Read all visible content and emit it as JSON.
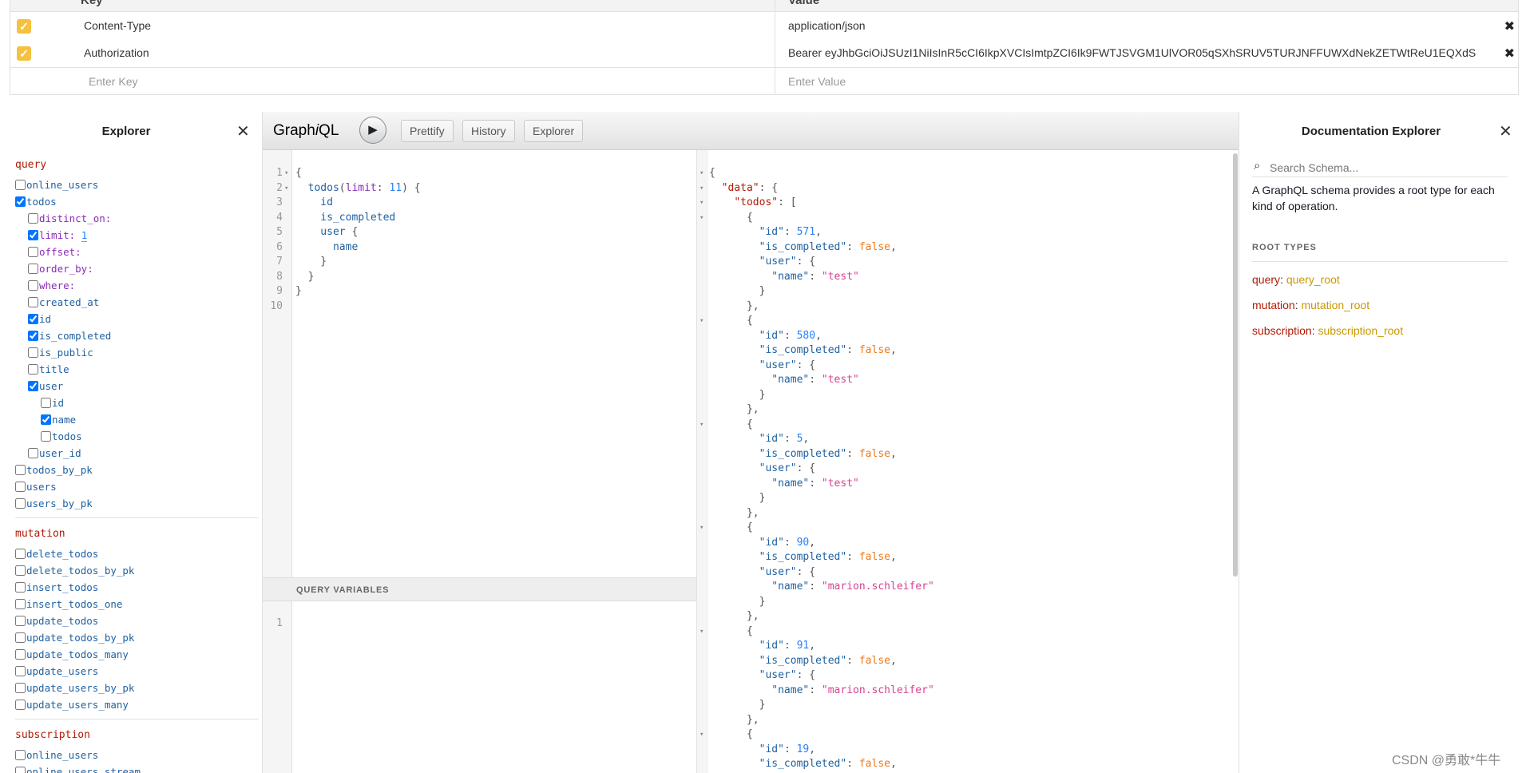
{
  "headers_table": {
    "col_key": "Key",
    "col_value": "Value",
    "rows": [
      {
        "key": "Content-Type",
        "value": "application/json",
        "checked": true
      },
      {
        "key": "Authorization",
        "value": "Bearer eyJhbGciOiJSUzI1NiIsInR5cCI6IkpXVCIsImtpZCI6Ik9FWTJSVGM1UlVOR05qSXhSRUV5TURJNFFUWXdNekZETWtReU1EQXdS",
        "checked": true
      }
    ],
    "new_key_placeholder": "Enter Key",
    "new_value_placeholder": "Enter Value",
    "check_glyph": "✓",
    "delete_glyph": "✖"
  },
  "explorer": {
    "title": "Explorer",
    "close_glyph": "✕",
    "query_label": "query",
    "query_items": {
      "online_users": "online_users",
      "todos": "todos",
      "distinct_on": "distinct_on:",
      "limit": "limit:",
      "limit_value": "1",
      "offset": "offset:",
      "order_by": "order_by:",
      "where": "where:",
      "created_at": "created_at",
      "id": "id",
      "is_completed": "is_completed",
      "is_public": "is_public",
      "title": "title",
      "user": "user",
      "user_id_child": "id",
      "user_name": "name",
      "user_todos": "todos",
      "user_id": "user_id",
      "todos_by_pk": "todos_by_pk",
      "users": "users",
      "users_by_pk": "users_by_pk"
    },
    "mutation_label": "mutation",
    "mutation_items": [
      "delete_todos",
      "delete_todos_by_pk",
      "insert_todos",
      "insert_todos_one",
      "update_todos",
      "update_todos_by_pk",
      "update_todos_many",
      "update_users",
      "update_users_by_pk",
      "update_users_many"
    ],
    "subscription_label": "subscription",
    "subscription_items": [
      "online_users",
      "online_users_stream"
    ]
  },
  "graphiql": {
    "logo_prefix": "Graph",
    "logo_i": "i",
    "logo_suffix": "QL",
    "run_glyph": "▶",
    "buttons": {
      "prettify": "Prettify",
      "history": "History",
      "explorer": "Explorer"
    },
    "query_variables_label": "QUERY VARIABLES",
    "variables_line_number": "1",
    "query_lines": [
      {
        "n": "1",
        "fold": true,
        "parts": [
          {
            "t": "{",
            "c": "c-punc"
          }
        ]
      },
      {
        "n": "2",
        "fold": true,
        "parts": [
          {
            "t": "  todos",
            "c": "c-field"
          },
          {
            "t": "(",
            "c": "c-punc"
          },
          {
            "t": "limit",
            "c": "c-attr"
          },
          {
            "t": ": ",
            "c": "c-punc"
          },
          {
            "t": "11",
            "c": "c-num"
          },
          {
            "t": ") {",
            "c": "c-punc"
          }
        ]
      },
      {
        "n": "3",
        "fold": false,
        "parts": [
          {
            "t": "    id",
            "c": "c-field"
          }
        ]
      },
      {
        "n": "4",
        "fold": false,
        "parts": [
          {
            "t": "    is_completed",
            "c": "c-field"
          }
        ]
      },
      {
        "n": "5",
        "fold": false,
        "parts": [
          {
            "t": "    user",
            "c": "c-field"
          },
          {
            "t": " {",
            "c": "c-punc"
          }
        ]
      },
      {
        "n": "6",
        "fold": false,
        "parts": [
          {
            "t": "      name",
            "c": "c-field"
          }
        ]
      },
      {
        "n": "7",
        "fold": false,
        "parts": [
          {
            "t": "    }",
            "c": "c-punc"
          }
        ]
      },
      {
        "n": "8",
        "fold": false,
        "parts": [
          {
            "t": "  }",
            "c": "c-punc"
          }
        ]
      },
      {
        "n": "9",
        "fold": false,
        "parts": [
          {
            "t": "}",
            "c": "c-punc"
          }
        ]
      },
      {
        "n": "10",
        "fold": false,
        "parts": []
      }
    ],
    "result_lines": [
      {
        "fold": true,
        "parts": [
          {
            "t": "{",
            "c": "c-punc"
          }
        ]
      },
      {
        "fold": true,
        "parts": [
          {
            "t": "  ",
            "c": "c-punc"
          },
          {
            "t": "\"data\"",
            "c": "c-key"
          },
          {
            "t": ": {",
            "c": "c-punc"
          }
        ]
      },
      {
        "fold": true,
        "parts": [
          {
            "t": "    ",
            "c": "c-punc"
          },
          {
            "t": "\"todos\"",
            "c": "c-key"
          },
          {
            "t": ": [",
            "c": "c-punc"
          }
        ]
      },
      {
        "fold": true,
        "parts": [
          {
            "t": "      {",
            "c": "c-punc"
          }
        ]
      },
      {
        "fold": false,
        "parts": [
          {
            "t": "        ",
            "c": "c-punc"
          },
          {
            "t": "\"id\"",
            "c": "c-field"
          },
          {
            "t": ": ",
            "c": "c-punc"
          },
          {
            "t": "571",
            "c": "c-num"
          },
          {
            "t": ",",
            "c": "c-punc"
          }
        ]
      },
      {
        "fold": false,
        "parts": [
          {
            "t": "        ",
            "c": "c-punc"
          },
          {
            "t": "\"is_completed\"",
            "c": "c-field"
          },
          {
            "t": ": ",
            "c": "c-punc"
          },
          {
            "t": "false",
            "c": "c-bool"
          },
          {
            "t": ",",
            "c": "c-punc"
          }
        ]
      },
      {
        "fold": false,
        "parts": [
          {
            "t": "        ",
            "c": "c-punc"
          },
          {
            "t": "\"user\"",
            "c": "c-field"
          },
          {
            "t": ": {",
            "c": "c-punc"
          }
        ]
      },
      {
        "fold": false,
        "parts": [
          {
            "t": "          ",
            "c": "c-punc"
          },
          {
            "t": "\"name\"",
            "c": "c-field"
          },
          {
            "t": ": ",
            "c": "c-punc"
          },
          {
            "t": "\"test\"",
            "c": "c-str"
          }
        ]
      },
      {
        "fold": false,
        "parts": [
          {
            "t": "        }",
            "c": "c-punc"
          }
        ]
      },
      {
        "fold": false,
        "parts": [
          {
            "t": "      },",
            "c": "c-punc"
          }
        ]
      },
      {
        "fold": true,
        "parts": [
          {
            "t": "      {",
            "c": "c-punc"
          }
        ]
      },
      {
        "fold": false,
        "parts": [
          {
            "t": "        ",
            "c": "c-punc"
          },
          {
            "t": "\"id\"",
            "c": "c-field"
          },
          {
            "t": ": ",
            "c": "c-punc"
          },
          {
            "t": "580",
            "c": "c-num"
          },
          {
            "t": ",",
            "c": "c-punc"
          }
        ]
      },
      {
        "fold": false,
        "parts": [
          {
            "t": "        ",
            "c": "c-punc"
          },
          {
            "t": "\"is_completed\"",
            "c": "c-field"
          },
          {
            "t": ": ",
            "c": "c-punc"
          },
          {
            "t": "false",
            "c": "c-bool"
          },
          {
            "t": ",",
            "c": "c-punc"
          }
        ]
      },
      {
        "fold": false,
        "parts": [
          {
            "t": "        ",
            "c": "c-punc"
          },
          {
            "t": "\"user\"",
            "c": "c-field"
          },
          {
            "t": ": {",
            "c": "c-punc"
          }
        ]
      },
      {
        "fold": false,
        "parts": [
          {
            "t": "          ",
            "c": "c-punc"
          },
          {
            "t": "\"name\"",
            "c": "c-field"
          },
          {
            "t": ": ",
            "c": "c-punc"
          },
          {
            "t": "\"test\"",
            "c": "c-str"
          }
        ]
      },
      {
        "fold": false,
        "parts": [
          {
            "t": "        }",
            "c": "c-punc"
          }
        ]
      },
      {
        "fold": false,
        "parts": [
          {
            "t": "      },",
            "c": "c-punc"
          }
        ]
      },
      {
        "fold": true,
        "parts": [
          {
            "t": "      {",
            "c": "c-punc"
          }
        ]
      },
      {
        "fold": false,
        "parts": [
          {
            "t": "        ",
            "c": "c-punc"
          },
          {
            "t": "\"id\"",
            "c": "c-field"
          },
          {
            "t": ": ",
            "c": "c-punc"
          },
          {
            "t": "5",
            "c": "c-num"
          },
          {
            "t": ",",
            "c": "c-punc"
          }
        ]
      },
      {
        "fold": false,
        "parts": [
          {
            "t": "        ",
            "c": "c-punc"
          },
          {
            "t": "\"is_completed\"",
            "c": "c-field"
          },
          {
            "t": ": ",
            "c": "c-punc"
          },
          {
            "t": "false",
            "c": "c-bool"
          },
          {
            "t": ",",
            "c": "c-punc"
          }
        ]
      },
      {
        "fold": false,
        "parts": [
          {
            "t": "        ",
            "c": "c-punc"
          },
          {
            "t": "\"user\"",
            "c": "c-field"
          },
          {
            "t": ": {",
            "c": "c-punc"
          }
        ]
      },
      {
        "fold": false,
        "parts": [
          {
            "t": "          ",
            "c": "c-punc"
          },
          {
            "t": "\"name\"",
            "c": "c-field"
          },
          {
            "t": ": ",
            "c": "c-punc"
          },
          {
            "t": "\"test\"",
            "c": "c-str"
          }
        ]
      },
      {
        "fold": false,
        "parts": [
          {
            "t": "        }",
            "c": "c-punc"
          }
        ]
      },
      {
        "fold": false,
        "parts": [
          {
            "t": "      },",
            "c": "c-punc"
          }
        ]
      },
      {
        "fold": true,
        "parts": [
          {
            "t": "      {",
            "c": "c-punc"
          }
        ]
      },
      {
        "fold": false,
        "parts": [
          {
            "t": "        ",
            "c": "c-punc"
          },
          {
            "t": "\"id\"",
            "c": "c-field"
          },
          {
            "t": ": ",
            "c": "c-punc"
          },
          {
            "t": "90",
            "c": "c-num"
          },
          {
            "t": ",",
            "c": "c-punc"
          }
        ]
      },
      {
        "fold": false,
        "parts": [
          {
            "t": "        ",
            "c": "c-punc"
          },
          {
            "t": "\"is_completed\"",
            "c": "c-field"
          },
          {
            "t": ": ",
            "c": "c-punc"
          },
          {
            "t": "false",
            "c": "c-bool"
          },
          {
            "t": ",",
            "c": "c-punc"
          }
        ]
      },
      {
        "fold": false,
        "parts": [
          {
            "t": "        ",
            "c": "c-punc"
          },
          {
            "t": "\"user\"",
            "c": "c-field"
          },
          {
            "t": ": {",
            "c": "c-punc"
          }
        ]
      },
      {
        "fold": false,
        "parts": [
          {
            "t": "          ",
            "c": "c-punc"
          },
          {
            "t": "\"name\"",
            "c": "c-field"
          },
          {
            "t": ": ",
            "c": "c-punc"
          },
          {
            "t": "\"marion.schleifer\"",
            "c": "c-str"
          }
        ]
      },
      {
        "fold": false,
        "parts": [
          {
            "t": "        }",
            "c": "c-punc"
          }
        ]
      },
      {
        "fold": false,
        "parts": [
          {
            "t": "      },",
            "c": "c-punc"
          }
        ]
      },
      {
        "fold": true,
        "parts": [
          {
            "t": "      {",
            "c": "c-punc"
          }
        ]
      },
      {
        "fold": false,
        "parts": [
          {
            "t": "        ",
            "c": "c-punc"
          },
          {
            "t": "\"id\"",
            "c": "c-field"
          },
          {
            "t": ": ",
            "c": "c-punc"
          },
          {
            "t": "91",
            "c": "c-num"
          },
          {
            "t": ",",
            "c": "c-punc"
          }
        ]
      },
      {
        "fold": false,
        "parts": [
          {
            "t": "        ",
            "c": "c-punc"
          },
          {
            "t": "\"is_completed\"",
            "c": "c-field"
          },
          {
            "t": ": ",
            "c": "c-punc"
          },
          {
            "t": "false",
            "c": "c-bool"
          },
          {
            "t": ",",
            "c": "c-punc"
          }
        ]
      },
      {
        "fold": false,
        "parts": [
          {
            "t": "        ",
            "c": "c-punc"
          },
          {
            "t": "\"user\"",
            "c": "c-field"
          },
          {
            "t": ": {",
            "c": "c-punc"
          }
        ]
      },
      {
        "fold": false,
        "parts": [
          {
            "t": "          ",
            "c": "c-punc"
          },
          {
            "t": "\"name\"",
            "c": "c-field"
          },
          {
            "t": ": ",
            "c": "c-punc"
          },
          {
            "t": "\"marion.schleifer\"",
            "c": "c-str"
          }
        ]
      },
      {
        "fold": false,
        "parts": [
          {
            "t": "        }",
            "c": "c-punc"
          }
        ]
      },
      {
        "fold": false,
        "parts": [
          {
            "t": "      },",
            "c": "c-punc"
          }
        ]
      },
      {
        "fold": true,
        "parts": [
          {
            "t": "      {",
            "c": "c-punc"
          }
        ]
      },
      {
        "fold": false,
        "parts": [
          {
            "t": "        ",
            "c": "c-punc"
          },
          {
            "t": "\"id\"",
            "c": "c-field"
          },
          {
            "t": ": ",
            "c": "c-punc"
          },
          {
            "t": "19",
            "c": "c-num"
          },
          {
            "t": ",",
            "c": "c-punc"
          }
        ]
      },
      {
        "fold": false,
        "parts": [
          {
            "t": "        ",
            "c": "c-punc"
          },
          {
            "t": "\"is_completed\"",
            "c": "c-field"
          },
          {
            "t": ": ",
            "c": "c-punc"
          },
          {
            "t": "false",
            "c": "c-bool"
          },
          {
            "t": ",",
            "c": "c-punc"
          }
        ]
      }
    ]
  },
  "docs": {
    "title": "Documentation Explorer",
    "close_glyph": "✕",
    "search_placeholder": "Search Schema...",
    "search_glyph": "⌕",
    "description": "A GraphQL schema provides a root type for each kind of operation.",
    "root_types_label": "ROOT TYPES",
    "root_types": [
      {
        "name": "query",
        "type": "query_root"
      },
      {
        "name": "mutation",
        "type": "mutation_root"
      },
      {
        "name": "subscription",
        "type": "subscription_root"
      }
    ]
  },
  "watermark": "CSDN @勇敢*牛牛"
}
